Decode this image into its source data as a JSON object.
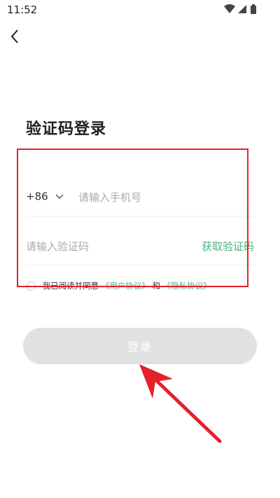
{
  "status_bar": {
    "time": "11:52",
    "icons": [
      "wifi-icon",
      "signal-icon",
      "battery-icon"
    ]
  },
  "header": {
    "back_icon": "chevron-left-icon",
    "title": "验证码登录"
  },
  "form": {
    "country_code": "+86",
    "phone_placeholder": "请输入手机号",
    "code_placeholder": "请输入验证码",
    "get_code_label": "获取验证码"
  },
  "agreement": {
    "prefix": "我已阅读并同意",
    "user_agreement": "《用户协议》",
    "conjunction": "和",
    "privacy_policy": "《隐私协议》"
  },
  "login_button": {
    "label": "登录"
  },
  "colors": {
    "accent": "#4fb07d",
    "button_disabled": "#e1e1e1",
    "annotation": "#e3212a"
  },
  "annotations": [
    "highlight-box",
    "arrow-pointer"
  ]
}
